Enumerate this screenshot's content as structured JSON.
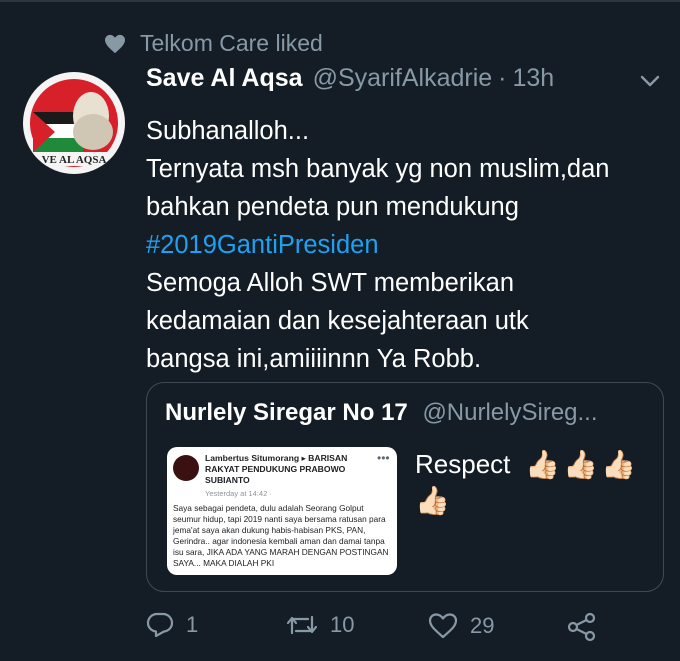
{
  "social_context": {
    "text": "Telkom Care liked",
    "icon": "heart-icon"
  },
  "tweet": {
    "display_name": "Save Al Aqsa",
    "handle": "@SyarifAlkadrie",
    "separator": "·",
    "time": "13h",
    "avatar_text": "VE AL AQSA",
    "text_line1": "Subhanalloh...\nTernyata msh banyak yg non muslim,dan\nbahkan pendeta pun mendukung",
    "hashtag": "#2019GantiPresiden",
    "text_line2": "Semoga Alloh SWT memberikan\nkedamaian dan kesejahteraan utk\nbangsa ini,amiiiinnn Ya Robb."
  },
  "quoted": {
    "display_name": "Nurlely Siregar No 17",
    "handle": "@NurlelySireg...",
    "text": "Respect",
    "emoji": "👍🏻",
    "image": {
      "author": "Lambertus Situmorang ▸ BARISAN RAKYAT PENDUKUNG PRABOWO SUBIANTO",
      "date": "Yesterday at 14:42 · ",
      "body": "Saya sebagai pendeta, dulu adalah Seorang Golput seumur hidup, tapi 2019 nanti saya bersama ratusan para jema'at saya akan dukung habis-habisan PKS, PAN, Gerindra.. agar indonesia kembali aman dan damai tanpa isu sara, JIKA ADA YANG MARAH DENGAN POSTINGAN SAYA... MAKA DIALAH PKI"
    }
  },
  "actions": {
    "replies": "1",
    "retweets": "10",
    "likes": "29"
  },
  "colors": {
    "background": "#141d26",
    "muted": "#8899a6",
    "link": "#1da1f2",
    "border": "#3d4a56"
  }
}
